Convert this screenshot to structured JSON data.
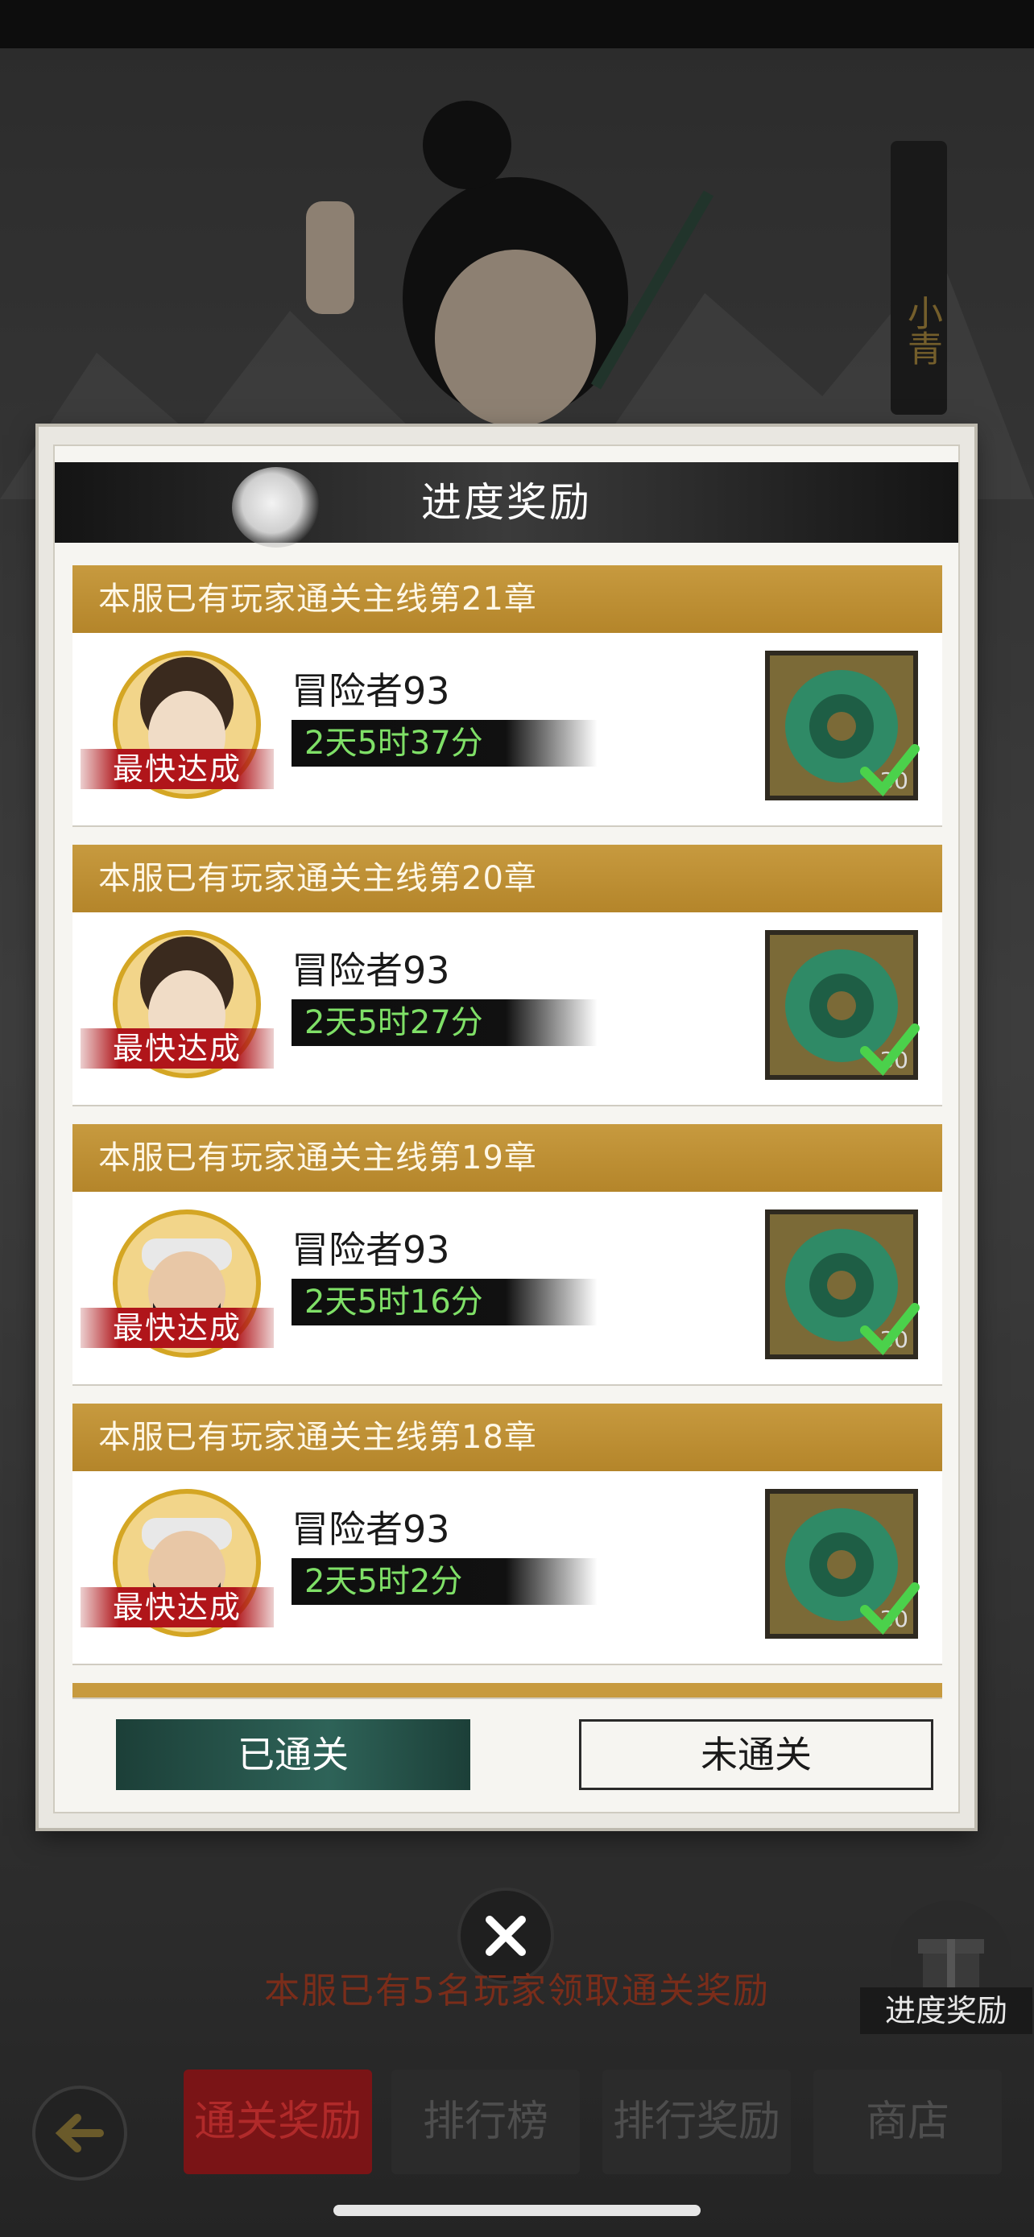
{
  "hero_name": "小青",
  "modal": {
    "title": "进度奖励",
    "records": [
      {
        "header": "本服已有玩家通关主线第21章",
        "badge": "最快达成",
        "player": "冒险者93",
        "time": "2天5时37分",
        "reward_count": "30",
        "claimed": true
      },
      {
        "header": "本服已有玩家通关主线第20章",
        "badge": "最快达成",
        "player": "冒险者93",
        "time": "2天5时27分",
        "reward_count": "30",
        "claimed": true
      },
      {
        "header": "本服已有玩家通关主线第19章",
        "badge": "最快达成",
        "player": "冒险者93",
        "time": "2天5时16分",
        "reward_count": "30",
        "claimed": true
      },
      {
        "header": "本服已有玩家通关主线第18章",
        "badge": "最快达成",
        "player": "冒险者93",
        "time": "2天5时2分",
        "reward_count": "30",
        "claimed": true
      }
    ],
    "tabs": {
      "active": "已通关",
      "inactive": "未通关"
    }
  },
  "close_icon": "close-icon",
  "background": {
    "notice": "本服已有5名玩家领取通关奖励",
    "progress_reward_label": "进度奖励"
  },
  "bottom_nav": {
    "items": [
      "通关奖励",
      "排行榜",
      "排行奖励",
      "商店"
    ],
    "active_index": 0
  },
  "colors": {
    "card_header": "#b4852a",
    "time_text": "#7fe067",
    "badge": "#b0151a",
    "active_tab": "#2e6358"
  }
}
